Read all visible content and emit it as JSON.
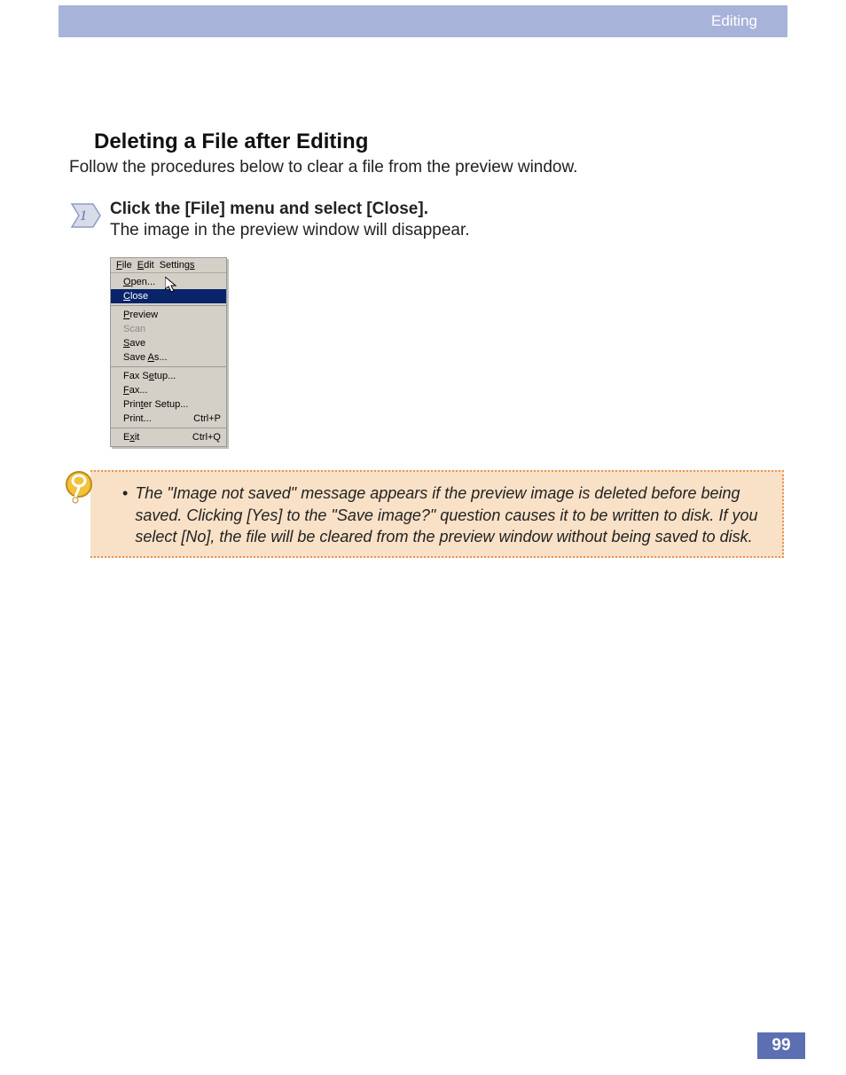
{
  "header": {
    "section": "Editing"
  },
  "heading": "Deleting a File after Editing",
  "intro": "Follow the procedures below to clear a file from the preview window.",
  "step1": {
    "title": "Click the [File] menu and select [Close].",
    "desc": "The image in the preview window will disappear."
  },
  "menu": {
    "bar": {
      "file": "File",
      "edit": "Edit",
      "settings": "Settings"
    },
    "items": {
      "open": "Open...",
      "close": "Close",
      "preview": "Preview",
      "scan": "Scan",
      "save": "Save",
      "save_as": "Save As...",
      "fax_setup": "Fax Setup...",
      "fax": "Fax...",
      "printer_setup": "Printer Setup...",
      "print": "Print...",
      "print_sc": "Ctrl+P",
      "exit": "Exit",
      "exit_sc": "Ctrl+Q"
    }
  },
  "tip": {
    "text": "The \"Image not saved\" message appears if the preview image is deleted before being saved. Clicking [Yes] to the \"Save image?\" question causes it to be written to disk. If you select [No], the file will be cleared from the preview window without being saved to disk."
  },
  "page_number": "99"
}
